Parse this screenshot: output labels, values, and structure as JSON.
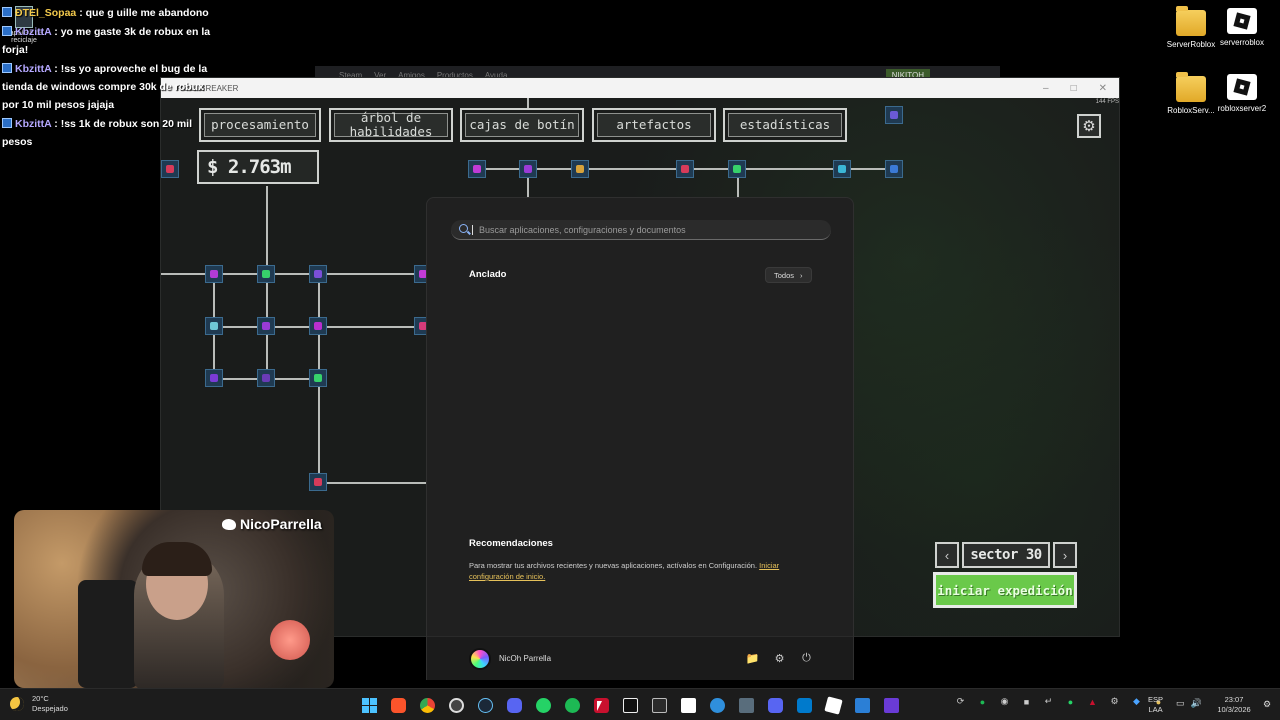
{
  "chat": {
    "messages": [
      {
        "user": "ÐTEl_Sopaa",
        "text": ": que g uille me abandono",
        "gold": true
      },
      {
        "user": "KbzittA",
        "text": ": yo me gaste 3k de robux en la forja!",
        "gold": false
      },
      {
        "user": "KbzittA",
        "text": ": !ss yo aproveche el bug de la tienda de windows compre 30k de robux por 10 mil pesos jajaja",
        "gold": false
      },
      {
        "user": "KbzittA",
        "text": ": !ss 1k de robux son 20 mil pesos",
        "gold": false
      }
    ]
  },
  "desktop": {
    "recycle_label": "Papelera de reciclaje",
    "icons": [
      {
        "label": "ServerRoblox",
        "kind": "folder"
      },
      {
        "label": "serverroblox",
        "kind": "roblox"
      },
      {
        "label": "RobloxServ...",
        "kind": "folder"
      },
      {
        "label": "robloxserver2",
        "kind": "roblox"
      }
    ]
  },
  "steam_bar": {
    "items": [
      "Steam",
      "Ver",
      "Amigos",
      "Productos",
      "Ayuda"
    ],
    "user": "NIKITOH"
  },
  "game": {
    "window_title": "ROCKBREAKER",
    "fps": "144 FPS",
    "tabs": [
      {
        "label": "procesamiento",
        "id": "processing"
      },
      {
        "label": "árbol de habilidades",
        "id": "skill-tree"
      },
      {
        "label": "cajas de botín",
        "id": "loot-boxes"
      },
      {
        "label": "artefactos",
        "id": "artifacts"
      },
      {
        "label": "estadísticas",
        "id": "stats"
      }
    ],
    "money": "$ 2.763m",
    "sector": "sector 30",
    "expedition": "iniciar expedición",
    "colors": {
      "accent_green": "#6ac94a",
      "node_blue": "#1f3a52",
      "frame": "#cfd2cf"
    }
  },
  "start_menu": {
    "search_placeholder": "Buscar aplicaciones, configuraciones y documentos",
    "pinned_title": "Anclado",
    "all_button": "Todos",
    "recommendations_title": "Recomendaciones",
    "recommendations_text": "Para mostrar tus archivos recientes y nuevas aplicaciones, actívalos en Configuración.",
    "recommendations_link": "Iniciar configuración de inicio.",
    "user_name": "NicOh Parrella"
  },
  "webcam": {
    "twitter_handle": "NicoParrella"
  },
  "taskbar": {
    "weather_temp": "20°C",
    "weather_desc": "Despejado",
    "lang_top": "ESP",
    "lang_bottom": "LAA",
    "time": "23:07",
    "date": "10/3/2026"
  }
}
